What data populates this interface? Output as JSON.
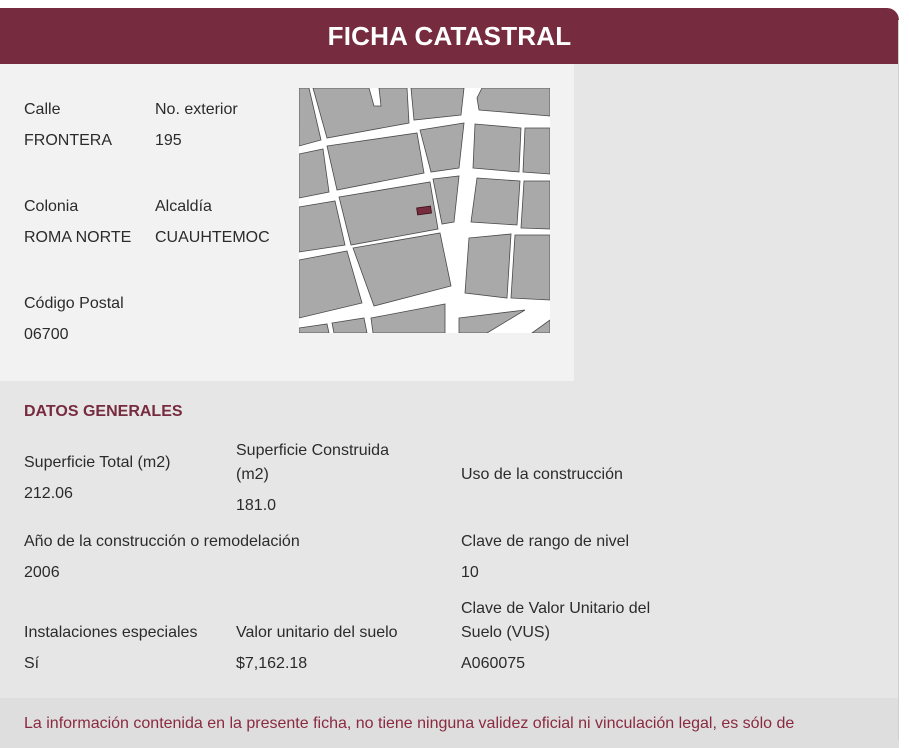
{
  "header": {
    "title": "FICHA CATASTRAL"
  },
  "address": {
    "calle_label": "Calle",
    "calle_value": "FRONTERA",
    "no_exterior_label": "No. exterior",
    "no_exterior_value": "195",
    "colonia_label": "Colonia",
    "colonia_value": "ROMA NORTE",
    "alcaldia_label": "Alcaldía",
    "alcaldia_value": "CUAUHTEMOC",
    "cp_label": "Código Postal",
    "cp_value": "06700"
  },
  "map": {
    "block_color": "#a9a9a9",
    "street_color": "#ffffff",
    "parcel_color": "#772b3e"
  },
  "general": {
    "section_title": "DATOS GENERALES",
    "superficie_total_label": "Superficie Total (m2)",
    "superficie_total_value": "212.06",
    "superficie_construida_label_line1": "Superficie Construida",
    "superficie_construida_label_line2": "(m2)",
    "superficie_construida_value": "181.0",
    "uso_label": "Uso de la construcción",
    "anio_label": "Año de la construcción o remodelación",
    "anio_value": "2006",
    "clave_rango_label": "Clave de rango de nivel",
    "clave_rango_value": "10",
    "instalaciones_label": "Instalaciones especiales",
    "instalaciones_value": "Sí",
    "valor_unitario_label": "Valor unitario del suelo",
    "valor_unitario_value": "$7,162.18",
    "clave_vus_label_line1": "Clave de Valor Unitario del",
    "clave_vus_label_line2": "Suelo (VUS)",
    "clave_vus_value": "A060075"
  },
  "disclaimer": {
    "text": "La información contenida en la presente ficha, no tiene ninguna validez oficial ni vinculación legal, es sólo de"
  },
  "colors": {
    "brand": "#772b3e",
    "panel": "#f2f2f2",
    "background": "#e6e6e6"
  }
}
